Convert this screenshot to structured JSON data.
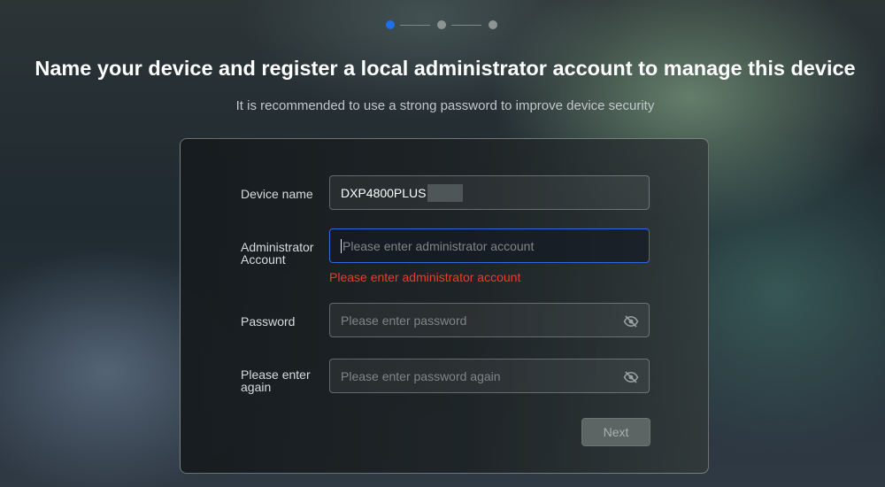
{
  "stepper": {
    "steps": 3,
    "current": 1
  },
  "header": {
    "title": "Name your device and register a local administrator account to manage this device",
    "subtitle": "It is recommended to use a strong password to improve device security"
  },
  "form": {
    "device_name": {
      "label": "Device name",
      "value": "DXP4800PLUS"
    },
    "admin_account": {
      "label_line1": "Administrator",
      "label_line2": "Account",
      "placeholder": "Please enter administrator account",
      "error": "Please enter administrator account"
    },
    "password": {
      "label": "Password",
      "placeholder": "Please enter password"
    },
    "password_again": {
      "label_line1": "Please enter",
      "label_line2": "again",
      "placeholder": "Please enter password again"
    },
    "next_label": "Next"
  },
  "colors": {
    "accent": "#1f6fe8",
    "error": "#ee3b2a",
    "focus_border": "#2f6ad9"
  },
  "icons": {
    "password_toggle": "eye-slash-icon"
  }
}
